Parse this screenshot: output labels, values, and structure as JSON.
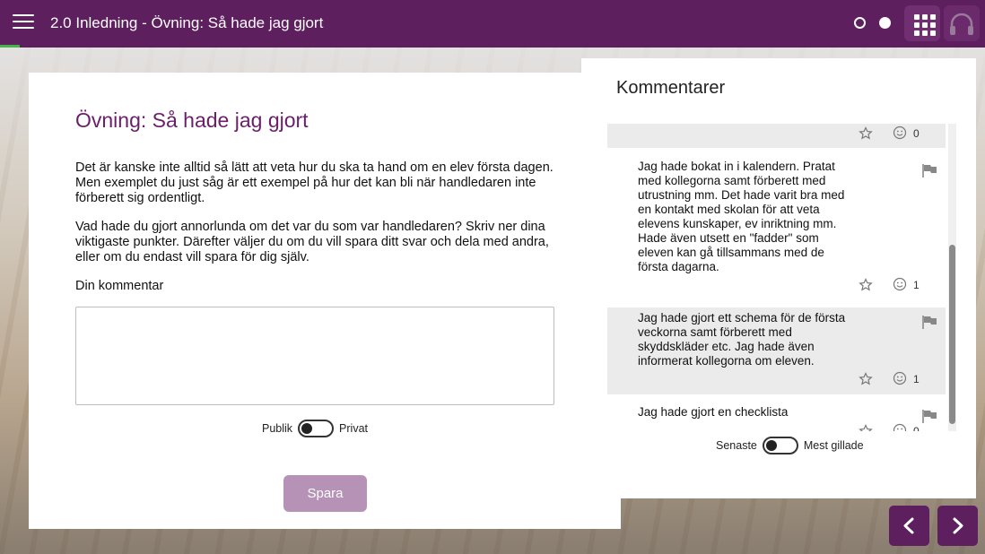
{
  "header": {
    "title": "2.0 Inledning - Övning: Så hade jag gjort",
    "progress_fraction": 0.02
  },
  "exercise": {
    "heading": "Övning: Så hade jag gjort",
    "paragraph1": "Det är kanske inte alltid så lätt att veta hur du ska ta hand om en elev första dagen. Men exemplet du just såg är ett exempel på hur det kan bli när handledaren inte förberett sig ordentligt.",
    "paragraph2": "Vad hade du gjort annorlunda om det var du som var handledaren? Skriv ner dina viktigaste punkter. Därefter väljer du om du vill spara ditt svar och dela med andra, eller om du endast vill spara för dig själv.",
    "comment_label": "Din kommentar",
    "comment_value": "",
    "toggle_left": "Publik",
    "toggle_right": "Privat",
    "save_label": "Spara"
  },
  "comments": {
    "title": "Kommentarer",
    "items": [
      {
        "text": "",
        "likes": "0"
      },
      {
        "text": "Jag hade bokat in i kalendern. Pratat med kollegorna samt förberett med utrustning mm. Det hade varit bra med en kontakt med skolan för att veta elevens kunskaper, ev inriktning mm. Hade även utsett en \"fadder\" som eleven kan gå tillsammans med de första dagarna.",
        "likes": "1"
      },
      {
        "text": "Jag hade gjort ett schema för de första veckorna samt förberett med skyddskläder etc. Jag hade även informerat kollegorna om eleven.",
        "likes": "1"
      },
      {
        "text": "Jag hade gjort en checklista",
        "likes": "0"
      }
    ],
    "sort_left": "Senaste",
    "sort_right": "Mest gillade"
  },
  "icons": {
    "menu": "menu-icon",
    "grid": "grid-icon",
    "headphones": "headphones-icon",
    "star": "star-icon",
    "smile": "smile-icon",
    "flag": "flag-icon",
    "prev": "chevron-left-icon",
    "next": "chevron-right-icon"
  },
  "colors": {
    "brand": "#5e1f5f",
    "heading": "#6b1f6b",
    "save_button": "#b692b7",
    "progress": "#46b34a"
  }
}
